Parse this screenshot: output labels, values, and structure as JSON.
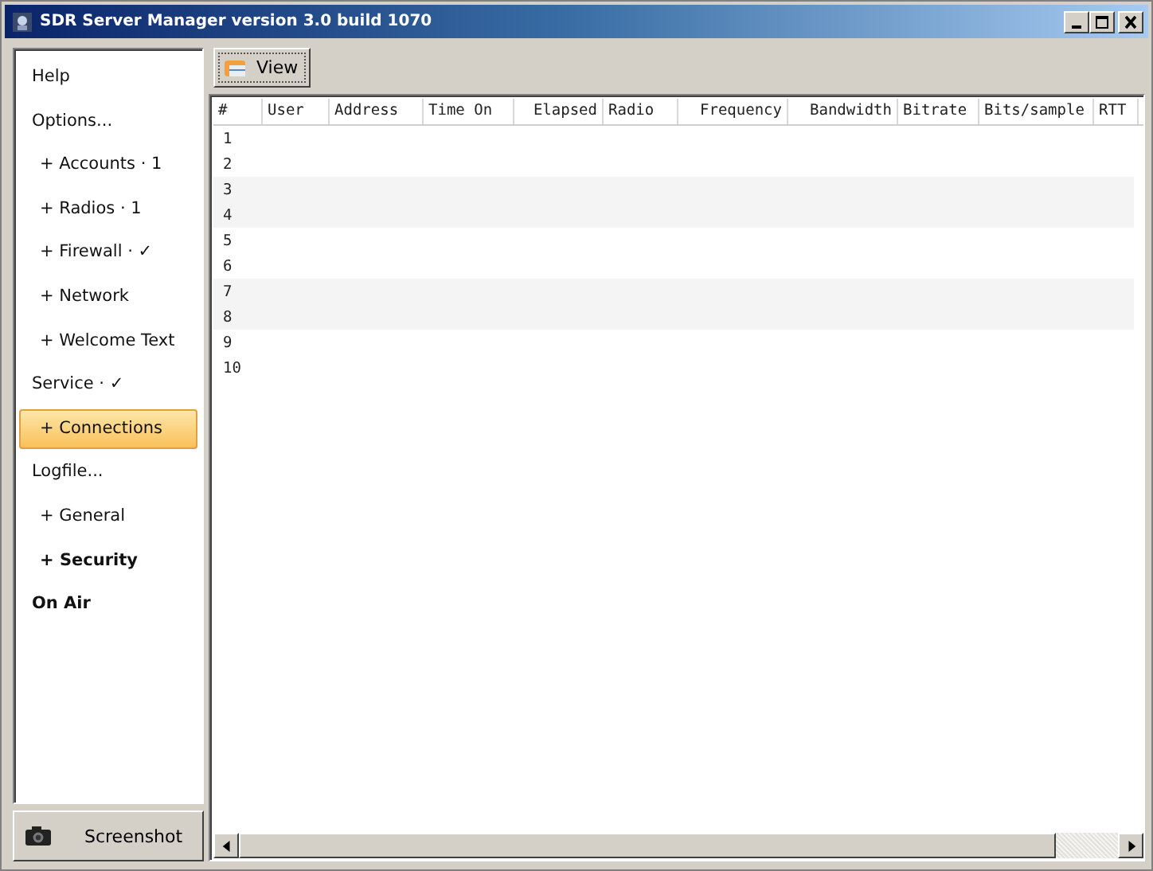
{
  "window": {
    "title": "SDR Server Manager version 3.0 build 1070"
  },
  "sidebar": {
    "items": [
      {
        "label": "Help",
        "kind": "header",
        "bold": false,
        "selected": false
      },
      {
        "label": "Options...",
        "kind": "header",
        "bold": false,
        "selected": false
      },
      {
        "label": "+ Accounts · 1",
        "kind": "sub",
        "bold": false,
        "selected": false
      },
      {
        "label": "+ Radios · 1",
        "kind": "sub",
        "bold": false,
        "selected": false
      },
      {
        "label": "+ Firewall · ✓",
        "kind": "sub",
        "bold": false,
        "selected": false
      },
      {
        "label": "+ Network",
        "kind": "sub",
        "bold": false,
        "selected": false
      },
      {
        "label": "+ Welcome Text",
        "kind": "sub",
        "bold": false,
        "selected": false
      },
      {
        "label": "Service · ✓",
        "kind": "header",
        "bold": false,
        "selected": false
      },
      {
        "label": "+ Connections",
        "kind": "sub",
        "bold": false,
        "selected": true
      },
      {
        "label": "Logfile...",
        "kind": "header",
        "bold": false,
        "selected": false
      },
      {
        "label": "+ General",
        "kind": "sub",
        "bold": false,
        "selected": false
      },
      {
        "label": "+ Security",
        "kind": "sub",
        "bold": true,
        "selected": false
      },
      {
        "label": "On Air",
        "kind": "header",
        "bold": true,
        "selected": false
      }
    ]
  },
  "screenshot_button": {
    "label": "Screenshot"
  },
  "toolbar": {
    "view_button": {
      "label": "View"
    }
  },
  "table": {
    "columns": [
      {
        "label": "#"
      },
      {
        "label": "User"
      },
      {
        "label": "Address"
      },
      {
        "label": "Time On"
      },
      {
        "label": "Elapsed"
      },
      {
        "label": "Radio"
      },
      {
        "label": "Frequency"
      },
      {
        "label": "Bandwidth"
      },
      {
        "label": "Bitrate"
      },
      {
        "label": "Bits/sample"
      },
      {
        "label": "RTT"
      }
    ],
    "rows": [
      "1",
      "2",
      "3",
      "4",
      "5",
      "6",
      "7",
      "8",
      "9",
      "10"
    ]
  }
}
